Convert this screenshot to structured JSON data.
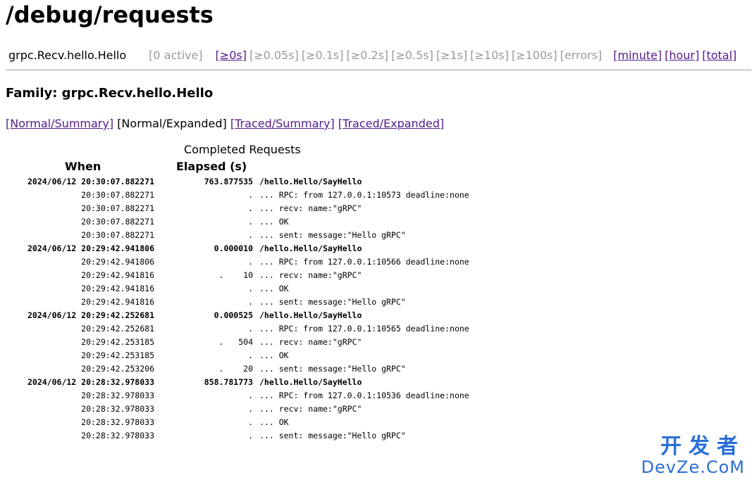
{
  "page": {
    "title": "/debug/requests"
  },
  "topbar": {
    "family": "grpc.Recv.hello.Hello",
    "active": "[0 active]",
    "buckets": [
      {
        "label": "[≥0s]",
        "link": true
      },
      {
        "label": "[≥0.05s]",
        "link": false
      },
      {
        "label": "[≥0.1s]",
        "link": false
      },
      {
        "label": "[≥0.2s]",
        "link": false
      },
      {
        "label": "[≥0.5s]",
        "link": false
      },
      {
        "label": "[≥1s]",
        "link": false
      },
      {
        "label": "[≥10s]",
        "link": false
      },
      {
        "label": "[≥100s]",
        "link": false
      },
      {
        "label": "[errors]",
        "link": false
      }
    ],
    "ranges": [
      "[minute]",
      "[hour]",
      "[total]"
    ]
  },
  "family_heading": "Family: grpc.Recv.hello.Hello",
  "views": {
    "normal_summary": "[Normal/Summary]",
    "normal_expanded": "[Normal/Expanded]",
    "traced_summary": "[Traced/Summary]",
    "traced_expanded": "[Traced/Expanded]"
  },
  "table": {
    "caption": "Completed Requests",
    "col_when": "When",
    "col_elapsed": "Elapsed (s)",
    "rows": [
      {
        "when": "2024/06/12 20:30:07.882271",
        "elapsed": "763.877535",
        "what": "/hello.Hello/SayHello",
        "first": true
      },
      {
        "when": "20:30:07.882271",
        "elapsed": ".",
        "what": "... RPC: from 127.0.0.1:10573 deadline:none",
        "first": false
      },
      {
        "when": "20:30:07.882271",
        "elapsed": ".",
        "what": "... recv: name:\"gRPC\"",
        "first": false
      },
      {
        "when": "20:30:07.882271",
        "elapsed": ".",
        "what": "... OK",
        "first": false
      },
      {
        "when": "20:30:07.882271",
        "elapsed": ".",
        "what": "... sent: message:\"Hello gRPC\"",
        "first": false
      },
      {
        "when": "2024/06/12 20:29:42.941806",
        "elapsed": "0.000010",
        "what": "/hello.Hello/SayHello",
        "first": true
      },
      {
        "when": "20:29:42.941806",
        "elapsed": ".",
        "what": "... RPC: from 127.0.0.1:10566 deadline:none",
        "first": false
      },
      {
        "when": "20:29:42.941816",
        "elapsed": ".    10",
        "what": "... recv: name:\"gRPC\"",
        "first": false
      },
      {
        "when": "20:29:42.941816",
        "elapsed": ".",
        "what": "... OK",
        "first": false
      },
      {
        "when": "20:29:42.941816",
        "elapsed": ".",
        "what": "... sent: message:\"Hello gRPC\"",
        "first": false
      },
      {
        "when": "2024/06/12 20:29:42.252681",
        "elapsed": "0.000525",
        "what": "/hello.Hello/SayHello",
        "first": true
      },
      {
        "when": "20:29:42.252681",
        "elapsed": ".",
        "what": "... RPC: from 127.0.0.1:10565 deadline:none",
        "first": false
      },
      {
        "when": "20:29:42.253185",
        "elapsed": ".   504",
        "what": "... recv: name:\"gRPC\"",
        "first": false
      },
      {
        "when": "20:29:42.253185",
        "elapsed": ".",
        "what": "... OK",
        "first": false
      },
      {
        "when": "20:29:42.253206",
        "elapsed": ".    20",
        "what": "... sent: message:\"Hello gRPC\"",
        "first": false
      },
      {
        "when": "2024/06/12 20:28:32.978033",
        "elapsed": "858.781773",
        "what": "/hello.Hello/SayHello",
        "first": true
      },
      {
        "when": "20:28:32.978033",
        "elapsed": ".",
        "what": "... RPC: from 127.0.0.1:10536 deadline:none",
        "first": false
      },
      {
        "when": "20:28:32.978033",
        "elapsed": ".",
        "what": "... recv: name:\"gRPC\"",
        "first": false
      },
      {
        "when": "20:28:32.978033",
        "elapsed": ".",
        "what": "... OK",
        "first": false
      },
      {
        "when": "20:28:32.978033",
        "elapsed": ".",
        "what": "... sent: message:\"Hello gRPC\"",
        "first": false
      }
    ]
  },
  "watermark": {
    "top": "开发者",
    "bottom": "DevZe.CoM"
  },
  "colors": {
    "link": "#551a8b",
    "disabled": "#9a9a9a",
    "watermark": "#2a6fd6"
  }
}
